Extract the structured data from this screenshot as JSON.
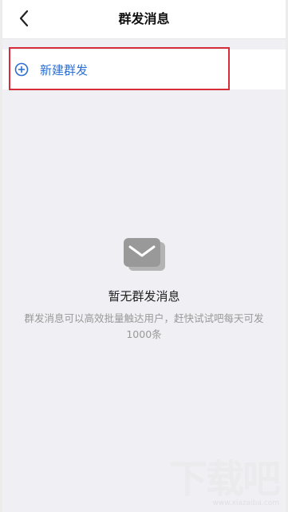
{
  "header": {
    "title": "群发消息",
    "back_icon": "chevron-left-icon"
  },
  "new_broadcast": {
    "label": "新建群发",
    "icon": "plus-circle-icon",
    "color": "#2c6fd1"
  },
  "highlight": {
    "color": "#d62d3b"
  },
  "empty_state": {
    "icon": "mail-icon",
    "title": "暂无群发消息",
    "description": "群发消息可以高效批量触达用户，赶快试试吧每天可发1000条"
  },
  "watermark": {
    "text": "下载吧",
    "url": "www.xiazaiba.com"
  }
}
